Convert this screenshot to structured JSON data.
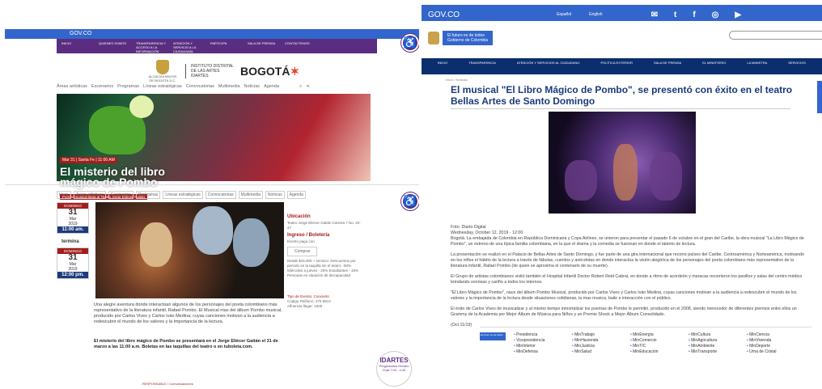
{
  "left": {
    "gov_label": "GOV.CO",
    "top_menu": [
      "INICIO",
      "QUIENES SOMOS",
      "TRANSPARENCIA Y ACCESO A LA INFORMACIÓN PÚBLICA",
      "ATENCIÓN Y SERVICIO A LA CIUDADANÍA",
      "PARTICIPA",
      "SALA DE PRENSA",
      "CONTÁCTENOS"
    ],
    "alcaldia": "ALCALDÍA MAYOR DE BOGOTÁ D.C.",
    "institute": "INSTITUTO DISTRITAL DE LAS ARTES IDARTES",
    "bogota": "BOGOTÁ",
    "subnav": [
      "Áreas artísticas",
      "Escenarios",
      "Programas",
      "Líneas estratégicas",
      "Convocatorias",
      "Multimedia",
      "Noticias",
      "Agenda"
    ],
    "hero": {
      "date_chip": "Mar 31 | Santa Fe | 11:00 AM",
      "title": "El misterio del libro mágico de Pombo",
      "subtitle": "Pombo musical llega al Teatro Jorge Eliécer Gaitán"
    },
    "subnav2": [
      "Inicio",
      "Áreas artísticas",
      "Escenarios",
      "Programas",
      "Líneas estratégicas",
      "Convocatorias",
      "Multimedia",
      "Noticias",
      "Agenda"
    ],
    "dates": [
      {
        "header": "DOMINGO",
        "day": "31",
        "month": "Mar",
        "year": "2019",
        "time": "11:00 am."
      },
      {
        "header": "DOMINGO",
        "day": "31",
        "month": "Mar",
        "year": "2019",
        "time": "12:00 pm."
      }
    ],
    "termina": "termina",
    "body1": "Una alegre aventura donde interactúan algunos de los personajes del poeta colombiano más representativo de la literatura infantil, Rafael Pombo. El Musical mas del álbum Pombo musical, producido por Carlos Vives y Carlos Iván Medina; cuyas canciones motivan a la audiencia a redescubrir el mundo de los valores y la importancia de la lectura.",
    "body2": "El misterio del libro mágico de Pombo se presentará en el Jorge Eliécer Gaitán el 31 de marzo a las 11:00 a.m. Boletas en las taquillas del teatro o en tuboleta.com.",
    "sidebar": {
      "ubicacion_title": "Ubicación",
      "ubicacion_text": "Teatro Jorge Eliécer Gaitán Carrera 7 No. 22-47",
      "ingreso_title": "Ingreso / Boletería",
      "ingreso_text": "Evento pago con",
      "comprar": "Comprar",
      "precios": "Desde $15.000 + servicio. Descuentos por periodo en la taquilla sin el teatro: -50% Miércoles a jueves - 20% Estudiantes - 15% Personas en situación de discapacidad",
      "tipo": "Tipo de Evento: Concierto",
      "codigo": "Código Teléfono: 379 8814",
      "afluencia": "Afluencia llegar: 1000"
    },
    "badge_logo": "IDARTES",
    "badge_text": "Pregúntanos Horario Chat 7:00 - 4:30",
    "footer": "RESPONSABLE / Comunicaciones"
  },
  "right": {
    "gov_label": "GOV.CO",
    "lang": [
      "Español",
      "English"
    ],
    "social": [
      "✉",
      "t",
      "f",
      "◎",
      "▶"
    ],
    "logo_text": "El futuro es de todos",
    "logo_sub": "Gobierno de Colombia",
    "nav": [
      "INICIO",
      "TRANSPARENCIA",
      "ATENCIÓN Y SERVICIOS AL CIUDADANO",
      "POLÍTICA EXTERIOR",
      "SALA DE PRENSA",
      "EL MINISTERIO",
      "LA MINISTRA",
      "SERVICIOS"
    ],
    "breadcrumb": "Inicio / Noticias",
    "title": "El musical \"El Libro Mágico de Pombo\", se presentó con éxito en el teatro Bellas Artes de Santo Domingo",
    "paragraphs": [
      "Foto: Diario Digital",
      "Wednesday, October 12, 2019 - 12:00",
      "Bogotá. La embajada de Colombia en República Dominicana y Copa Airlines, se unieron para presentar el pasado 6 de octubre en el gran del Caribe, la obra musical \"La Libro Mágico de Pombo\", un estreno de una típica familia colombiana, en la que el drama y la comedia se fusionan en donde el talento de lectura.",
      "La presentación se realizó en el Palacio de Bellas Artes de Santo Domingo, y fue parte de una gira internacional que recorre países del Caribe, Centroamérica y Norteamérica, motivando en los niños el hábito de la lectura a través de fábulas, cuentos y anécdotas en donde interactúa la visión alegórica de los personajes del poeta colombiano más representativo de la literatura infantil, Rafael Pombo (de quien se aproxima el centenario de su muerte).",
      "El Grupo de artistas colombianos visitó también el Hospital Infantil Doctor Robert Reid Cabral, en donde a ritmo de acordeón y maracas recorrieron los pasillos y salas del centro médico brindando sonrisas y cariño a todos los internos.",
      "\"El Libro Mágico de Pombo\", nace del álbum Pombo Musical, producido por Carlos Vives y Carlos Iván Medina, cuyas canciones motivan a la audiencia a redescubrir el mundo de los valores y la importancia de la lectura desde situaciones cotidianas, la mas musica, baile e interacción con el público.",
      "El éxito de Carlos Vives de musicalizar y al mismo tiempo inmortalizar los poemas de Pombo le permitió, producido en el 2008, siendo merecedor de diferentes premios entre ellos un Grammy de la Academia por Mejor Álbum de Música para Niños y un Premio Shock a Mejor Álbum Consolidado.",
      "(Oct 11/19)"
    ],
    "footer_logo": "El futuro es de todos",
    "footer_cols": [
      [
        "Presidencia",
        "Vicepresidencia",
        "MinInterior",
        "MinDefensa"
      ],
      [
        "MinTrabajo",
        "MinHacienda",
        "MinJusticia",
        "MinSalud"
      ],
      [
        "MinEnergía",
        "MinComercio",
        "MinTIC",
        "MinEducación"
      ],
      [
        "MinCultura",
        "MinAgricultura",
        "MinAmbiente",
        "MinTransporte"
      ],
      [
        "MinCiencia",
        "MinVivienda",
        "MinDeporte",
        "Urna de Cristal"
      ]
    ]
  }
}
